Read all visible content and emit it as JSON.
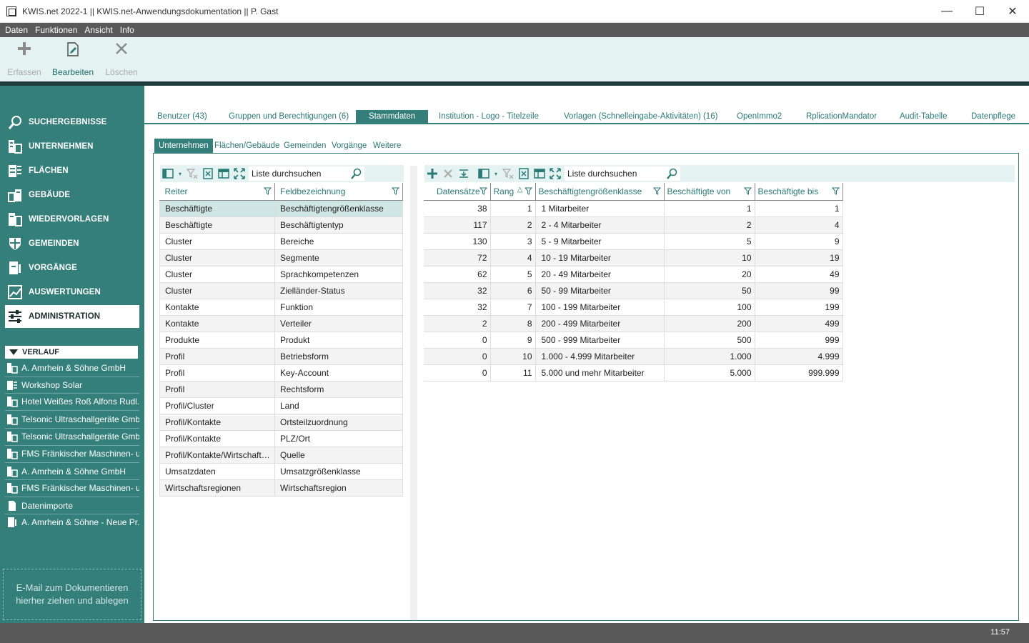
{
  "window": {
    "title": "KWIS.net 2022-1 || KWIS.net-Anwendungsdokumentation || P. Gast",
    "minimize": "—",
    "maximize": "☐",
    "close": "✕"
  },
  "menu": [
    "Daten",
    "Funktionen",
    "Ansicht",
    "Info"
  ],
  "ribbon": [
    {
      "label": "Erfassen",
      "icon": "plus-icon",
      "enabled": false
    },
    {
      "label": "Bearbeiten",
      "icon": "edit-icon",
      "enabled": true
    },
    {
      "label": "Löschen",
      "icon": "delete-icon",
      "enabled": false
    }
  ],
  "sidebar": {
    "nav": [
      {
        "label": "SUCHERGEBNISSE",
        "icon": "search-icon"
      },
      {
        "label": "UNTERNEHMEN",
        "icon": "building-icon"
      },
      {
        "label": "FLÄCHEN",
        "icon": "area-icon"
      },
      {
        "label": "GEBÄUDE",
        "icon": "buildings-icon"
      },
      {
        "label": "WIEDERVORLAGEN",
        "icon": "resubmission-icon"
      },
      {
        "label": "GEMEINDEN",
        "icon": "shield-icon"
      },
      {
        "label": "VORGÄNGE",
        "icon": "process-icon"
      },
      {
        "label": "AUSWERTUNGEN",
        "icon": "chart-icon"
      },
      {
        "label": "ADMINISTRATION",
        "icon": "settings-icon",
        "active": true
      }
    ],
    "history_title": "VERLAUF",
    "history": [
      "A. Amrhein & Söhne GmbH",
      "Workshop Solar",
      "Hotel Weißes Roß Alfons Rudl...",
      "Telsonic Ultraschallgeräte Gmb...",
      "Telsonic Ultraschallgeräte Gmb...",
      "FMS Fränkischer Maschinen- u...",
      "A. Amrhein & Söhne GmbH",
      "FMS Fränkischer Maschinen- u...",
      "Datenimporte",
      "A. Amrhein & Söhne - Neue Pr..."
    ],
    "dropzone": "E-Mail  zum Dokumentieren hierher ziehen und ablegen"
  },
  "tabs_top": [
    "Benutzer (43)",
    "Gruppen und Berechtigungen (6)",
    "Stammdaten",
    "Institution - Logo - Titelzeile",
    "Vorlagen (Schnelleingabe-Aktivitäten) (16)",
    "OpenImmo2",
    "RplicationMandator",
    "Audit-Tabelle",
    "Datenpflege"
  ],
  "tabs_sub": [
    "Unternehmen",
    "Flächen/Gebäude",
    "Gemeinden",
    "Vorgänge",
    "Weitere"
  ],
  "left_grid": {
    "search_placeholder": "Liste durchsuchen",
    "columns": [
      "Reiter",
      "Feldbezeichnung"
    ],
    "rows": [
      [
        "Beschäftigte",
        "Beschäftigtengrößenklasse"
      ],
      [
        "Beschäftigte",
        "Beschäftigtentyp"
      ],
      [
        "Cluster",
        "Bereiche"
      ],
      [
        "Cluster",
        "Segmente"
      ],
      [
        "Cluster",
        "Sprachkompetenzen"
      ],
      [
        "Cluster",
        "Zielländer-Status"
      ],
      [
        "Kontakte",
        "Funktion"
      ],
      [
        "Kontakte",
        "Verteiler"
      ],
      [
        "Produkte",
        "Produkt"
      ],
      [
        "Profil",
        "Betriebsform"
      ],
      [
        "Profil",
        "Key-Account"
      ],
      [
        "Profil",
        "Rechtsform"
      ],
      [
        "Profil/Cluster",
        "Land"
      ],
      [
        "Profil/Kontakte",
        "Ortsteilzuordnung"
      ],
      [
        "Profil/Kontakte",
        "PLZ/Ort"
      ],
      [
        "Profil/Kontakte/Wirtschaftsr...",
        "Quelle"
      ],
      [
        "Umsatzdaten",
        "Umsatzgrößenklasse"
      ],
      [
        "Wirtschaftsregionen",
        "Wirtschaftsregion"
      ]
    ],
    "selected_row": 0
  },
  "right_grid": {
    "search_placeholder": "Liste durchsuchen",
    "columns": [
      "Datensätze",
      "Rang",
      "Beschäftigtengrößenklasse",
      "Beschäftigte von",
      "Beschäftigte bis"
    ],
    "rows": [
      [
        "38",
        "1",
        "1 Mitarbeiter",
        "1",
        "1"
      ],
      [
        "117",
        "2",
        "2 - 4 Mitarbeiter",
        "2",
        "4"
      ],
      [
        "130",
        "3",
        "5 - 9 Mitarbeiter",
        "5",
        "9"
      ],
      [
        "72",
        "4",
        "10 - 19 Mitarbeiter",
        "10",
        "19"
      ],
      [
        "62",
        "5",
        "20 - 49 Mitarbeiter",
        "20",
        "49"
      ],
      [
        "32",
        "6",
        "50 - 99 Mitarbeiter",
        "50",
        "99"
      ],
      [
        "32",
        "7",
        "100 - 199 Mitarbeiter",
        "100",
        "199"
      ],
      [
        "2",
        "8",
        "200 - 499 Mitarbeiter",
        "200",
        "499"
      ],
      [
        "0",
        "9",
        "500 - 999 Mitarbeiter",
        "500",
        "999"
      ],
      [
        "0",
        "10",
        "1.000 - 4.999 Mitarbeiter",
        "1.000",
        "4.999"
      ],
      [
        "0",
        "11",
        "5.000 und mehr Mitarbeiter",
        "5.000",
        "999.999"
      ]
    ]
  },
  "status": {
    "time": "11:57"
  },
  "colors": {
    "accent": "#357f7b",
    "dark": "#1f3e3d",
    "ribbon": "#e4f2f1"
  }
}
